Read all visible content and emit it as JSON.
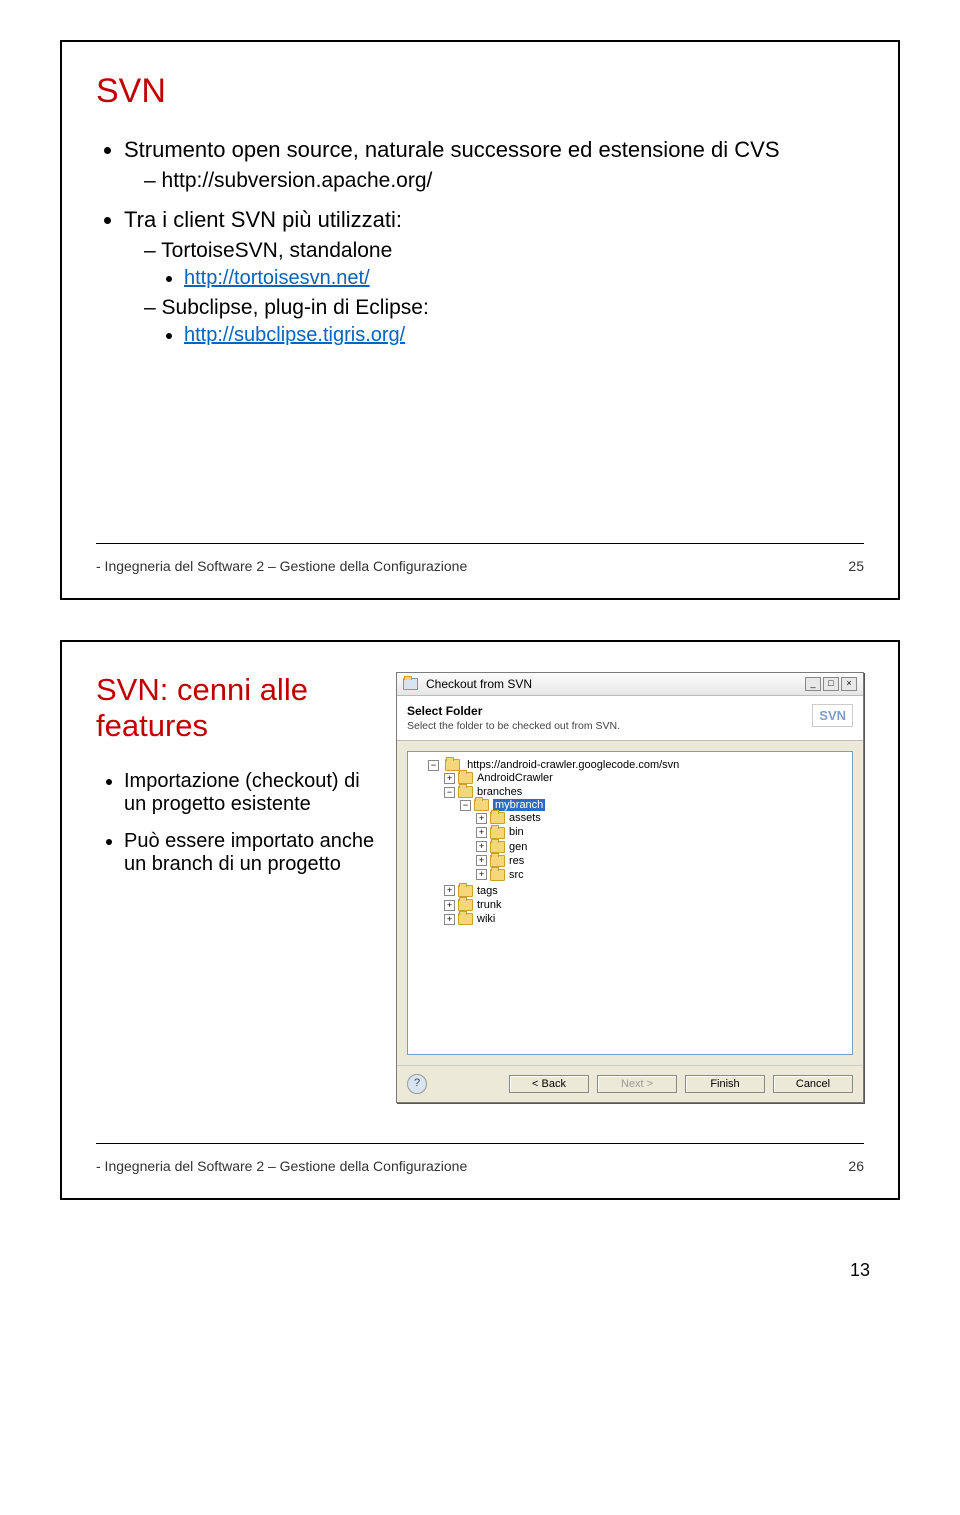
{
  "page_number": "13",
  "slide1": {
    "title": "SVN",
    "b1": "Strumento open source, naturale successore ed estensione di CVS",
    "b1_link": "http://subversion.apache.org/",
    "b2": "Tra i client SVN più utilizzati:",
    "b2a": "TortoiseSVN, standalone",
    "b2a_link": "http://tortoisesvn.net/",
    "b2b": "Subclipse, plug-in di Eclipse:",
    "b2b_link": "http://subclipse.tigris.org/",
    "footer": "- Ingegneria del Software 2 – Gestione della Configurazione",
    "slide_num": "25"
  },
  "slide2": {
    "title": "SVN: cenni alle features",
    "b1": "Importazione (checkout) di un progetto esistente",
    "b2": "Può essere importato anche un branch di un progetto",
    "footer": "- Ingegneria del Software 2 – Gestione della Configurazione",
    "slide_num": "26",
    "dialog": {
      "title": "Checkout from SVN",
      "head": "Select Folder",
      "sub": "Select the folder to be checked out from SVN.",
      "badge": "SVN",
      "root": "https://android-crawler.googlecode.com/svn",
      "nodes": {
        "android": "AndroidCrawler",
        "branches": "branches",
        "mybranch": "mybranch",
        "assets": "assets",
        "bin": "bin",
        "gen": "gen",
        "res": "res",
        "src": "src",
        "tags": "tags",
        "trunk": "trunk",
        "wiki": "wiki"
      },
      "buttons": {
        "back": "< Back",
        "next": "Next >",
        "finish": "Finish",
        "cancel": "Cancel"
      }
    }
  }
}
